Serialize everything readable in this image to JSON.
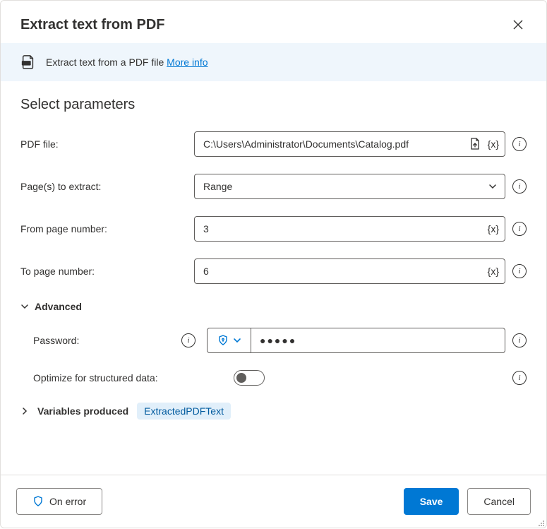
{
  "header": {
    "title": "Extract text from PDF"
  },
  "info_bar": {
    "description": "Extract text from a PDF file",
    "link": "More info"
  },
  "section_title": "Select parameters",
  "fields": {
    "pdf_file": {
      "label": "PDF file:",
      "value": "C:\\Users\\Administrator\\Documents\\Catalog.pdf"
    },
    "pages_to_extract": {
      "label": "Page(s) to extract:",
      "value": "Range"
    },
    "from_page": {
      "label": "From page number:",
      "value": "3"
    },
    "to_page": {
      "label": "To page number:",
      "value": "6"
    }
  },
  "advanced": {
    "label": "Advanced",
    "password": {
      "label": "Password:",
      "value": "●●●●●"
    },
    "optimize": {
      "label": "Optimize for structured data:",
      "enabled": false
    }
  },
  "variables": {
    "label": "Variables produced",
    "items": [
      "ExtractedPDFText"
    ]
  },
  "footer": {
    "on_error": "On error",
    "save": "Save",
    "cancel": "Cancel"
  },
  "icons": {
    "variable_token": "{x}"
  }
}
